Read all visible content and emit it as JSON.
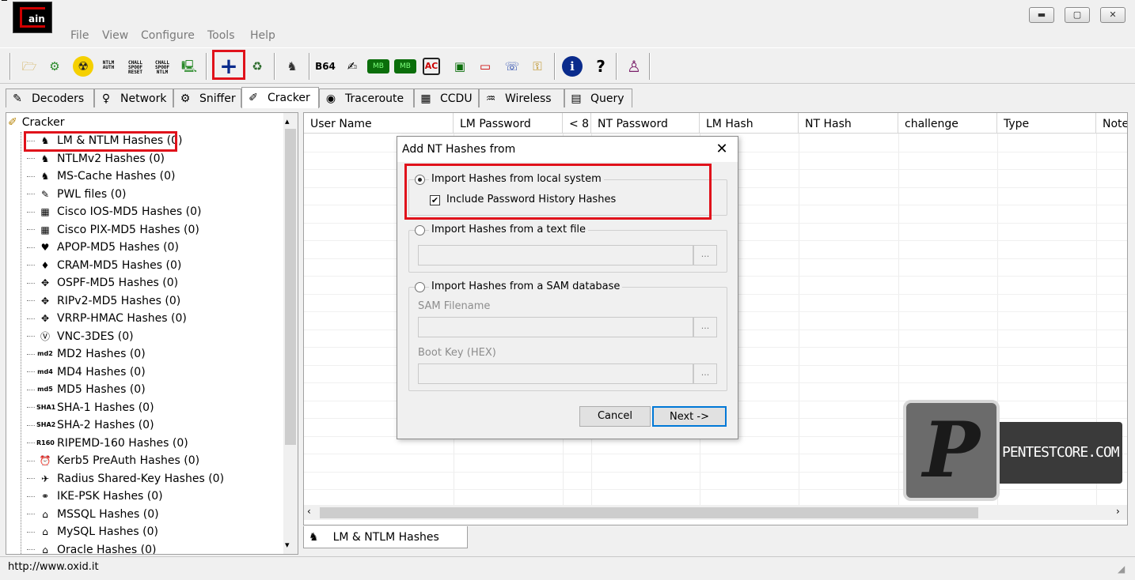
{
  "app": {
    "logo_text": "ain",
    "sysmenu_glyph": "▔"
  },
  "menu": [
    "File",
    "View",
    "Configure",
    "Tools",
    "Help"
  ],
  "window_controls": {
    "minimize": "▬",
    "maximize": "▢",
    "close": "✕"
  },
  "toolbar": {
    "ntlm_auth": "NTLM AUTH",
    "chall_spoof_reset": "CHALL SPOOF RESET",
    "chall_spoof_ntlm": "CHALL SPOOF NTLM",
    "b64": "B64",
    "mb1": "MB",
    "mb2": "MB",
    "ac": "AC",
    "icons": [
      "open-folder-icon",
      "start-sniffer-icon",
      "apr-poison-icon",
      "ntlm-auth-icon",
      "chall-spoof-reset-icon",
      "chall-spoof-ntlm-icon",
      "monitor-icon",
      "add-hashes-icon",
      "delete-icon",
      "ntlm-crack-icon",
      "base64-icon",
      "lookup-icon",
      "mb-icon-1",
      "mb-icon-2",
      "vnc-icon",
      "terminal-icon",
      "dialog-icon",
      "cisco-icon",
      "keys-icon",
      "info-icon",
      "help-icon",
      "user-icon"
    ]
  },
  "tabs": [
    {
      "label": "Decoders",
      "icon": "decoders-icon",
      "glyph": "✎"
    },
    {
      "label": "Network",
      "icon": "network-icon",
      "glyph": "♀"
    },
    {
      "label": "Sniffer",
      "icon": "sniffer-icon",
      "glyph": "⚙"
    },
    {
      "label": "Cracker",
      "icon": "cracker-icon",
      "glyph": "✐"
    },
    {
      "label": "Traceroute",
      "icon": "traceroute-icon",
      "glyph": "◉"
    },
    {
      "label": "CCDU",
      "icon": "ccdu-icon",
      "glyph": "▦"
    },
    {
      "label": "Wireless",
      "icon": "wireless-icon",
      "glyph": "♒"
    },
    {
      "label": "Query",
      "icon": "query-icon",
      "glyph": "▤"
    }
  ],
  "tree": {
    "root": "Cracker",
    "items": [
      {
        "label": "LM & NTLM Hashes (0)",
        "icon": "user-hash-icon",
        "glyph": "♞"
      },
      {
        "label": "NTLMv2 Hashes (0)",
        "icon": "user-hash-icon",
        "glyph": "♞"
      },
      {
        "label": "MS-Cache Hashes (0)",
        "icon": "user-hash-icon",
        "glyph": "♞"
      },
      {
        "label": "PWL files (0)",
        "icon": "pwl-icon",
        "glyph": "✎"
      },
      {
        "label": "Cisco IOS-MD5 Hashes (0)",
        "icon": "cisco-icon",
        "glyph": "▦"
      },
      {
        "label": "Cisco PIX-MD5 Hashes (0)",
        "icon": "cisco-icon",
        "glyph": "▦"
      },
      {
        "label": "APOP-MD5 Hashes (0)",
        "icon": "apop-icon",
        "glyph": "♥"
      },
      {
        "label": "CRAM-MD5 Hashes (0)",
        "icon": "cram-icon",
        "glyph": "♦"
      },
      {
        "label": "OSPF-MD5 Hashes (0)",
        "icon": "routing-icon",
        "glyph": "✥"
      },
      {
        "label": "RIPv2-MD5 Hashes (0)",
        "icon": "routing-icon",
        "glyph": "✥"
      },
      {
        "label": "VRRP-HMAC Hashes (0)",
        "icon": "routing-icon",
        "glyph": "✥"
      },
      {
        "label": "VNC-3DES (0)",
        "icon": "vnc-icon",
        "glyph": "Ⓥ"
      },
      {
        "label": "MD2 Hashes (0)",
        "icon": "md-icon",
        "glyph": "md2"
      },
      {
        "label": "MD4 Hashes (0)",
        "icon": "md-icon",
        "glyph": "md4"
      },
      {
        "label": "MD5 Hashes (0)",
        "icon": "md-icon",
        "glyph": "md5"
      },
      {
        "label": "SHA-1 Hashes (0)",
        "icon": "sha-icon",
        "glyph": "SHA1"
      },
      {
        "label": "SHA-2 Hashes (0)",
        "icon": "sha-icon",
        "glyph": "SHA2"
      },
      {
        "label": "RIPEMD-160 Hashes (0)",
        "icon": "ripemd-icon",
        "glyph": "R160"
      },
      {
        "label": "Kerb5 PreAuth Hashes (0)",
        "icon": "kerberos-icon",
        "glyph": "⏰"
      },
      {
        "label": "Radius Shared-Key Hashes (0)",
        "icon": "radius-icon",
        "glyph": "✈"
      },
      {
        "label": "IKE-PSK Hashes (0)",
        "icon": "ike-icon",
        "glyph": "⚭"
      },
      {
        "label": "MSSQL Hashes (0)",
        "icon": "db-icon",
        "glyph": "⌂"
      },
      {
        "label": "MySQL Hashes (0)",
        "icon": "db-icon",
        "glyph": "⌂"
      },
      {
        "label": "Oracle Hashes (0)",
        "icon": "db-icon",
        "glyph": "⌂"
      }
    ]
  },
  "grid": {
    "columns": [
      "User Name",
      "LM Password",
      "< 8",
      "NT Password",
      "LM Hash",
      "NT Hash",
      "challenge",
      "Type",
      "Note"
    ]
  },
  "bottom_tab": {
    "label": "LM & NTLM Hashes"
  },
  "status": {
    "text": "http://www.oxid.it"
  },
  "dialog": {
    "title": "Add NT Hashes from",
    "opt_local": "Import Hashes from local system",
    "chk_history": "Include Password History Hashes",
    "opt_text": "Import Hashes from a text file",
    "opt_sam": "Import Hashes from a SAM database",
    "sam_filename": "SAM Filename",
    "boot_key": "Boot Key (HEX)",
    "browse": "...",
    "cancel": "Cancel",
    "next": "Next ->"
  },
  "watermark": {
    "letter": "P",
    "site": "PENTESTCORE.COM"
  },
  "colors": {
    "highlight_red": "#e0121b",
    "brand_red": "#d00000"
  }
}
